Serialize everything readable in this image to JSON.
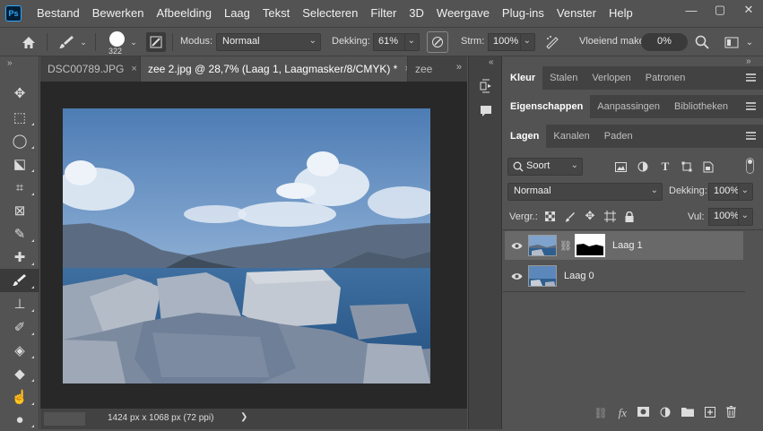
{
  "app": {
    "logo": "Ps"
  },
  "menu": [
    "Bestand",
    "Bewerken",
    "Afbeelding",
    "Laag",
    "Tekst",
    "Selecteren",
    "Filter",
    "3D",
    "Weergave",
    "Plug-ins",
    "Venster",
    "Help"
  ],
  "window_controls": {
    "minimize": "—",
    "maximize": "▢",
    "close": "✕"
  },
  "options": {
    "brush_size": "322",
    "mode_label": "Modus:",
    "mode_value": "Normaal",
    "opacity_label": "Dekking:",
    "opacity_value": "61%",
    "flow_label": "Strm:",
    "flow_value": "100%",
    "smoothing_label": "Vloeiend maken:",
    "smoothing_value": "0%"
  },
  "tools": [
    "move-tool",
    "marquee-tool",
    "lasso-tool",
    "object-selection-tool",
    "crop-tool",
    "frame-tool",
    "eyedropper-tool",
    "healing-brush-tool",
    "brush-tool",
    "stamp-tool",
    "history-brush-tool",
    "eraser-tool",
    "paint-bucket-tool",
    "smudge-tool",
    "dodge-tool"
  ],
  "tool_icons": [
    "✥",
    "⬚",
    "◯",
    "⬕",
    "⌗",
    "⊠",
    "✎",
    "✚",
    "🖌",
    "⊥",
    "✐",
    "◈",
    "◆",
    "☝",
    "●"
  ],
  "doc_tabs": [
    {
      "label": "DSC00789.JPG",
      "close": "×"
    },
    {
      "label": "zee 2.jpg @ 28,7% (Laag 1, Laagmasker/8/CMYK) *",
      "close": "×"
    },
    {
      "label": "zee",
      "close": ""
    }
  ],
  "status": {
    "info": "1424 px x 1068 px (72 ppi)",
    "arrow": "❯"
  },
  "panel_tabs_1": [
    "Kleur",
    "Stalen",
    "Verlopen",
    "Patronen"
  ],
  "panel_tabs_2": [
    "Eigenschappen",
    "Aanpassingen",
    "Bibliotheken"
  ],
  "panel_tabs_3": [
    "Lagen",
    "Kanalen",
    "Paden"
  ],
  "layers_panel": {
    "filter_label": "Soort",
    "blend_mode": "Normaal",
    "opacity_label": "Dekking:",
    "opacity_value": "100%",
    "lock_label": "Vergr.:",
    "fill_label": "Vul:",
    "fill_value": "100%"
  },
  "layers": [
    {
      "name": "Laag 1",
      "selected": true,
      "has_mask": true
    },
    {
      "name": "Laag 0",
      "selected": false,
      "has_mask": false
    }
  ],
  "colors": {
    "accent": "#31a8ff",
    "panel": "#535353",
    "dark": "#424242",
    "canvas_bg": "#282828",
    "selected_row": "#696969"
  }
}
